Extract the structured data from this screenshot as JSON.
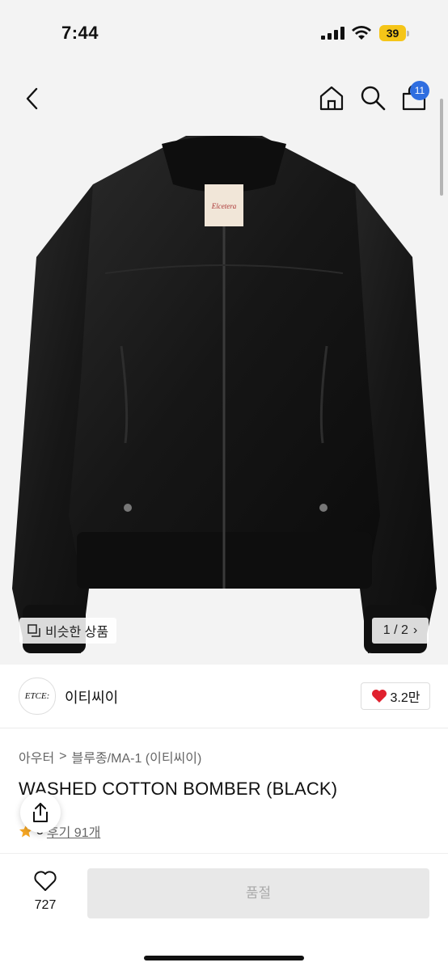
{
  "status": {
    "time": "7:44",
    "battery": "39"
  },
  "nav": {
    "cart_count": "11"
  },
  "gallery": {
    "similar_label": "비슷한 상품",
    "counter": "1 / 2",
    "counter_arrow": "›"
  },
  "brand": {
    "logo_text": "ETCE:",
    "name": "이티씨이",
    "likes": "3.2만"
  },
  "product": {
    "breadcrumb_1": "아우터",
    "breadcrumb_sep": ">",
    "breadcrumb_2": "블루종/MA-1 (이티씨이)",
    "title": "WASHED COTTON BOMBER (BLACK)",
    "rating_digit": "5",
    "reviews": "후기 91개"
  },
  "bottom": {
    "wish_count": "727",
    "soldout_label": "품절"
  },
  "colors": {
    "badge_blue": "#2f6ee0",
    "battery_yellow": "#f5c518",
    "heart_red": "#e0212e",
    "star_orange": "#f5a623"
  }
}
